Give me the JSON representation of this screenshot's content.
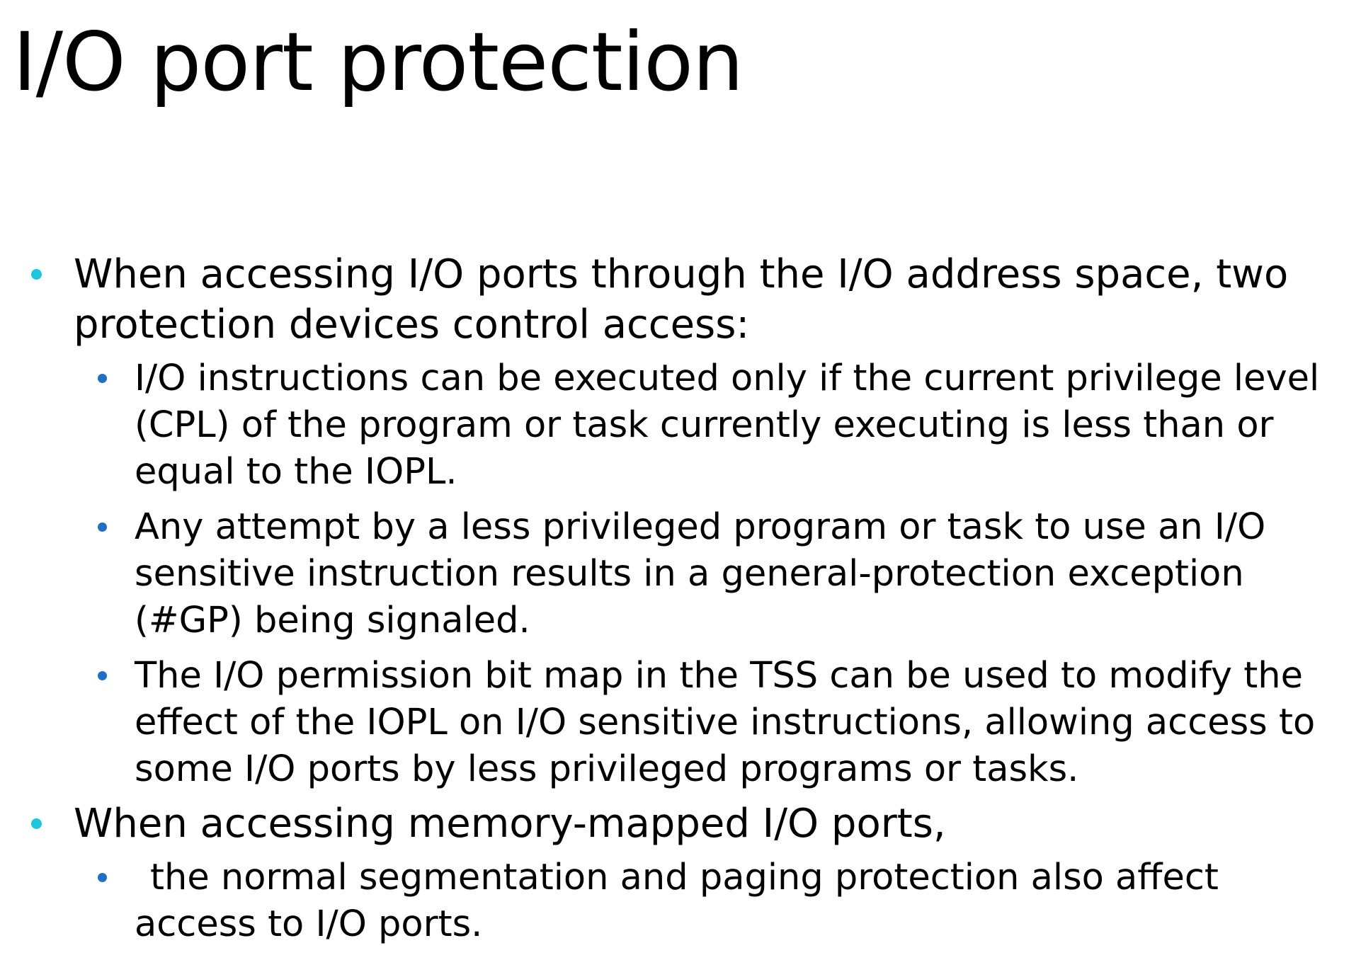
{
  "slide": {
    "title": "I/O port protection",
    "bullets": [
      {
        "text": "When accessing I/O ports through the I/O address space, two protection devices control access:",
        "sub": [
          {
            "text": "I/O instructions can be executed only if the current privilege level (CPL) of the program or task currently executing is less than or equal to the IOPL."
          },
          {
            "text": "Any attempt by a less privileged program or task to use an I/O sensitive instruction results in a general-protection exception (#GP) being signaled."
          },
          {
            "text": "The I/O permission bit map in the TSS can be used to modify the effect of the IOPL on I/O sensitive instructions, allowing access to some I/O ports by less privileged programs or tasks."
          }
        ]
      },
      {
        "text": "When accessing memory-mapped I/O ports,",
        "sub": [
          {
            "text": "the normal segmentation and paging protection also affect access to I/O ports."
          }
        ]
      }
    ]
  },
  "colors": {
    "level1_bullet": "#1cc6dc",
    "level2_bullet": "#1c70c8",
    "text": "#000000",
    "background": "#ffffff"
  }
}
